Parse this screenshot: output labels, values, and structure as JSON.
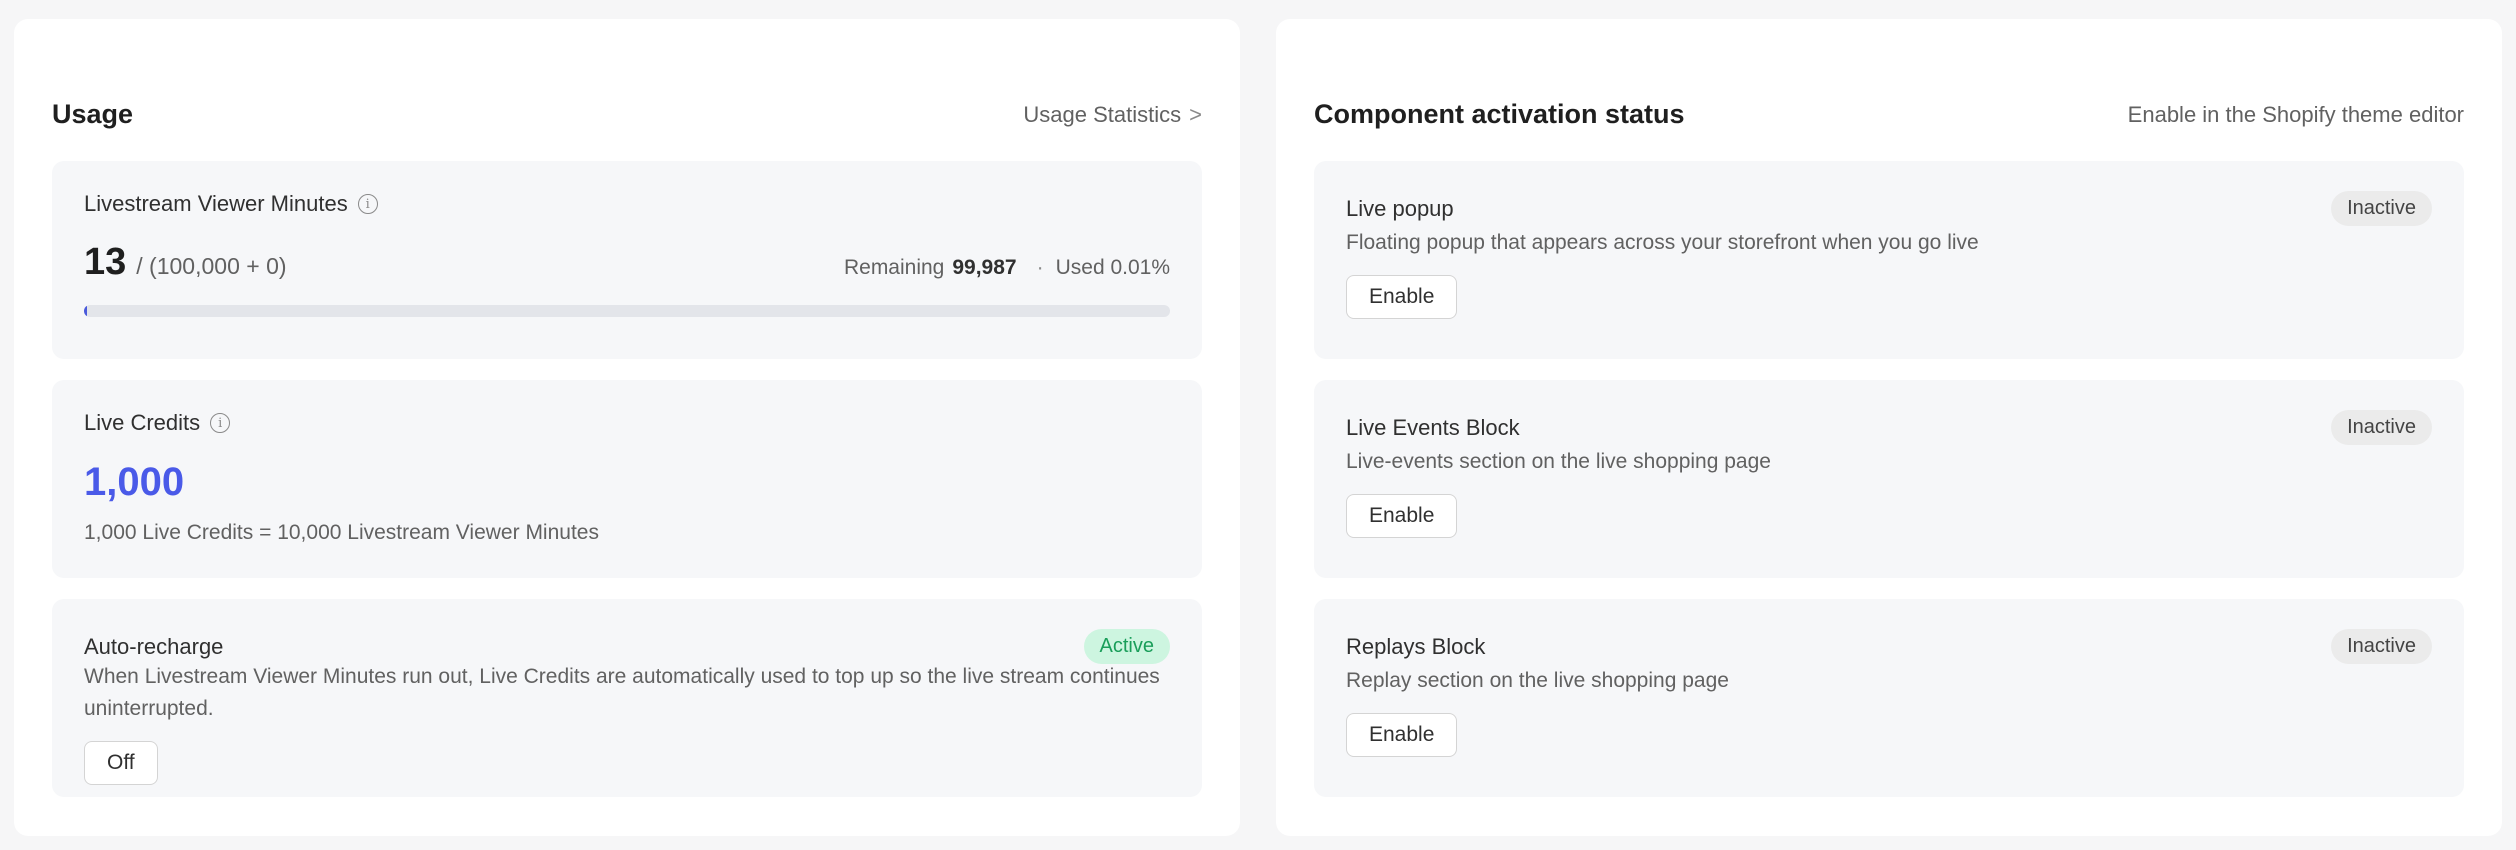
{
  "usage": {
    "title": "Usage",
    "link_label": "Usage Statistics",
    "link_chevron": ">",
    "viewer_minutes": {
      "title": "Livestream Viewer Minutes",
      "used": "13",
      "total": "/ (100,000 + 0)",
      "remaining_label": "Remaining",
      "remaining_value": "99,987",
      "used_sep": "·",
      "used_pct_label": "Used 0.01%",
      "progress_fraction": 0.0001,
      "progress_color": "#4a5adb"
    },
    "credits": {
      "title": "Live Credits",
      "value": "1,000",
      "note": "1,000 Live Credits = 10,000 Livestream Viewer Minutes",
      "value_color": "#4a5ae8"
    },
    "auto_recharge": {
      "title": "Auto-recharge",
      "badge": "Active",
      "description": "When Livestream Viewer Minutes run out, Live Credits are automatically used to top up so the live stream continues uninterrupted.",
      "button_label": "Off"
    }
  },
  "components": {
    "title": "Component activation status",
    "hint": "Enable in the Shopify theme editor",
    "items": [
      {
        "title": "Live popup",
        "badge": "Inactive",
        "description": "Floating popup that appears across your storefront when you go live",
        "button_label": "Enable"
      },
      {
        "title": "Live Events Block",
        "badge": "Inactive",
        "description": "Live-events section on the live shopping page",
        "button_label": "Enable"
      },
      {
        "title": "Replays Block",
        "badge": "Inactive",
        "description": "Replay section on the live shopping page",
        "button_label": "Enable"
      }
    ]
  },
  "icons": {
    "info": "info-circle-icon",
    "chevron": "chevron-right-icon"
  }
}
